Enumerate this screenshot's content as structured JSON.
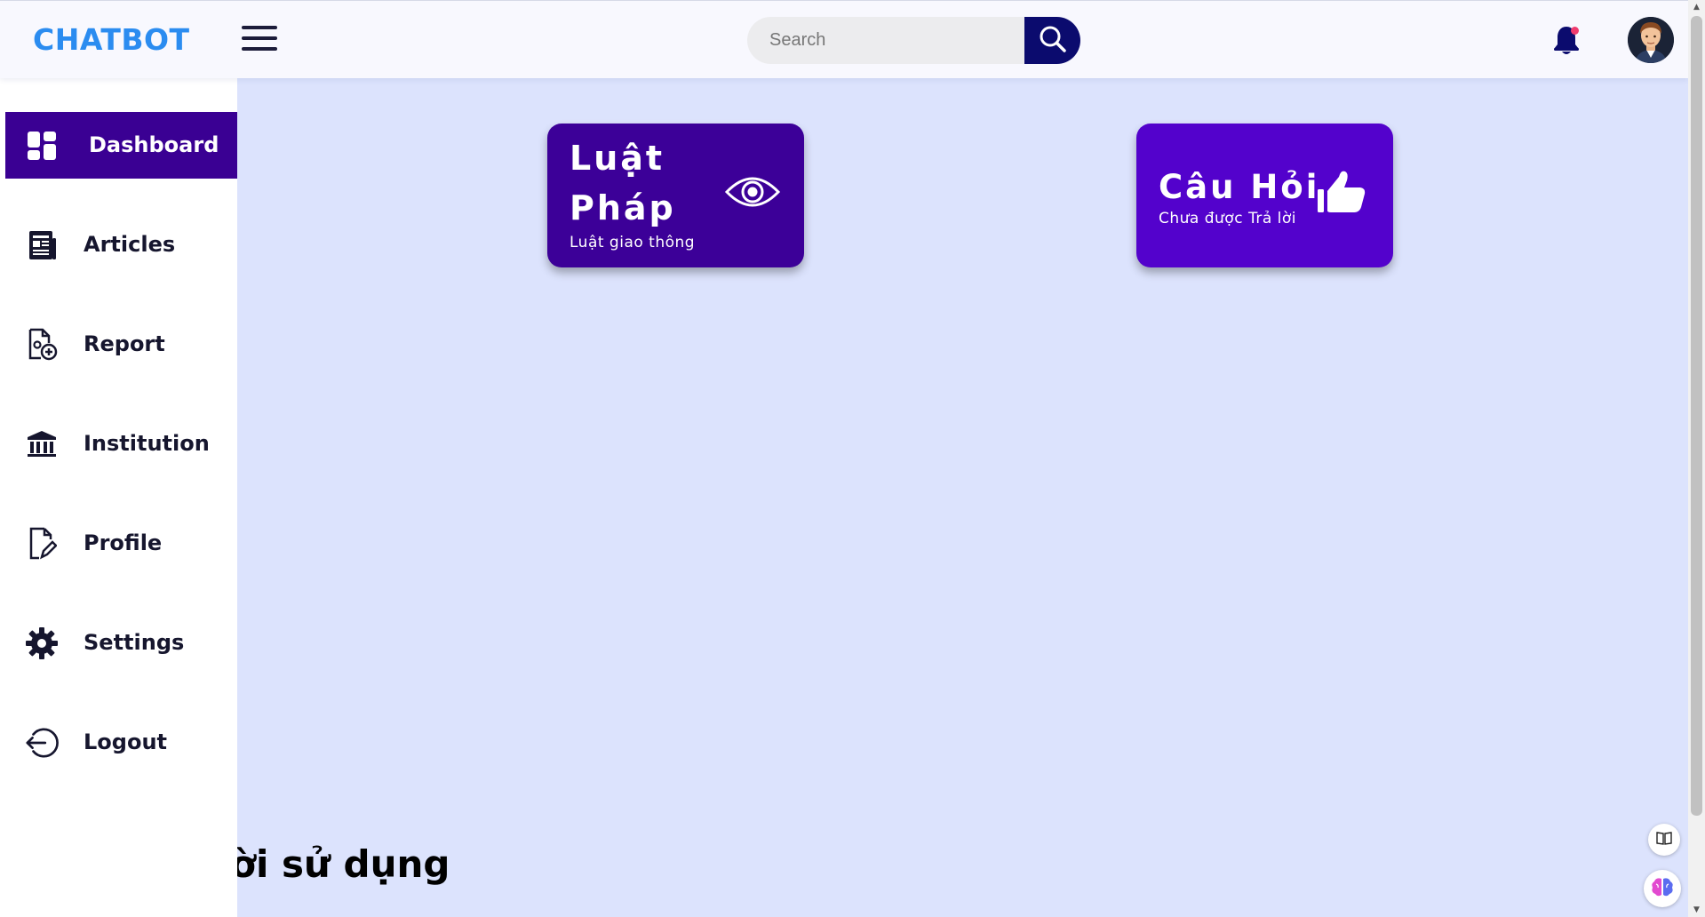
{
  "header": {
    "logo": "CHATBOT",
    "search": {
      "placeholder": "Search",
      "value": ""
    }
  },
  "sidebar": {
    "items": [
      {
        "label": "Dashboard",
        "icon": "dashboard-grid-icon",
        "active": true
      },
      {
        "label": "Articles",
        "icon": "newspaper-icon",
        "active": false
      },
      {
        "label": "Report",
        "icon": "report-add-icon",
        "active": false
      },
      {
        "label": "Institution",
        "icon": "bank-building-icon",
        "active": false
      },
      {
        "label": "Profile",
        "icon": "edit-document-icon",
        "active": false
      },
      {
        "label": "Settings",
        "icon": "gear-icon",
        "active": false
      },
      {
        "label": "Logout",
        "icon": "logout-icon",
        "active": false
      }
    ]
  },
  "cards": [
    {
      "title": "Luật Pháp",
      "subtitle": "Luật giao thông",
      "icon": "eye-icon",
      "color": "#3c0098"
    },
    {
      "title": "Câu Hỏi",
      "subtitle": "Chưa được Trả lời",
      "icon": "thumbs-up-icon",
      "color": "#5302cc"
    }
  ],
  "main": {
    "footer_text": "Người sử dụng"
  },
  "colors": {
    "accent": "#3a0093",
    "logo": "#2b8cf0",
    "background": "#dce3fd",
    "search_button": "#0b0b6e"
  }
}
